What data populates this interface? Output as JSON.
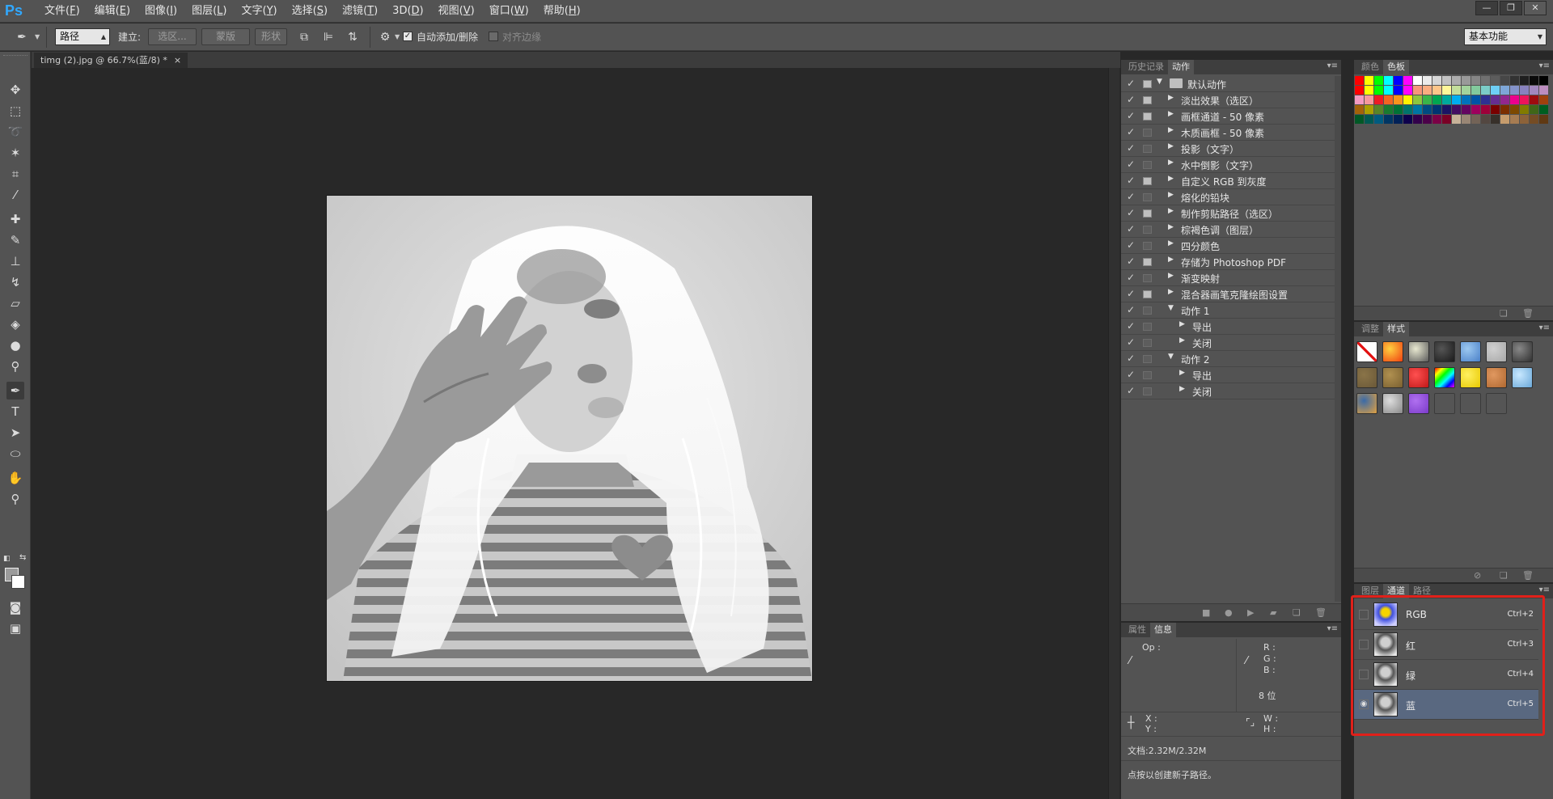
{
  "app": {
    "logo": "Ps"
  },
  "menu": [
    {
      "label": "文件",
      "key": "F"
    },
    {
      "label": "编辑",
      "key": "E"
    },
    {
      "label": "图像",
      "key": "I"
    },
    {
      "label": "图层",
      "key": "L"
    },
    {
      "label": "文字",
      "key": "Y"
    },
    {
      "label": "选择",
      "key": "S"
    },
    {
      "label": "滤镜",
      "key": "T"
    },
    {
      "label": "3D",
      "key": "D"
    },
    {
      "label": "视图",
      "key": "V"
    },
    {
      "label": "窗口",
      "key": "W"
    },
    {
      "label": "帮助",
      "key": "H"
    }
  ],
  "window_controls": {
    "minimize": "—",
    "restore": "❐",
    "close": "✕"
  },
  "options": {
    "mode_select": "路径",
    "make_label": "建立:",
    "selection_btn": "选区...",
    "mask_btn": "蒙版",
    "shape_btn": "形状",
    "auto_add_delete_label": "自动添加/删除",
    "auto_add_delete_checked": true,
    "align_edges_label": "对齐边缘",
    "align_edges_checked": false,
    "workspace": "基本功能"
  },
  "document": {
    "tab_title": "timg (2).jpg @ 66.7%(蓝/8) *",
    "tab_close": "×"
  },
  "panels": {
    "history_tab": "历史记录",
    "actions_tab": "动作",
    "properties_tab": "属性",
    "info_tab": "信息",
    "color_tab": "颜色",
    "swatches_tab": "色板",
    "adjustments_tab": "调整",
    "styles_tab": "样式",
    "layers_tab": "图层",
    "channels_tab": "通道",
    "paths_tab": "路径"
  },
  "actions": [
    {
      "label": "默认动作",
      "level": 0,
      "type": "set",
      "expanded": true,
      "dialog": true
    },
    {
      "label": "淡出效果（选区）",
      "level": 1,
      "expanded": false,
      "dialog": true
    },
    {
      "label": "画框通道 - 50 像素",
      "level": 1,
      "expanded": false,
      "dialog": true
    },
    {
      "label": "木质画框 - 50 像素",
      "level": 1,
      "expanded": false,
      "dialog": false
    },
    {
      "label": "投影（文字）",
      "level": 1,
      "expanded": false,
      "dialog": false
    },
    {
      "label": "水中倒影（文字）",
      "level": 1,
      "expanded": false,
      "dialog": false
    },
    {
      "label": "自定义 RGB 到灰度",
      "level": 1,
      "expanded": false,
      "dialog": true
    },
    {
      "label": "熔化的铅块",
      "level": 1,
      "expanded": false,
      "dialog": false
    },
    {
      "label": "制作剪贴路径（选区）",
      "level": 1,
      "expanded": false,
      "dialog": true
    },
    {
      "label": "棕褐色调（图层）",
      "level": 1,
      "expanded": false,
      "dialog": false
    },
    {
      "label": "四分颜色",
      "level": 1,
      "expanded": false,
      "dialog": false
    },
    {
      "label": "存储为 Photoshop PDF",
      "level": 1,
      "expanded": false,
      "dialog": true
    },
    {
      "label": "渐变映射",
      "level": 1,
      "expanded": false,
      "dialog": false
    },
    {
      "label": "混合器画笔克隆绘图设置",
      "level": 1,
      "expanded": false,
      "dialog": true
    },
    {
      "label": "动作 1",
      "level": 1,
      "expanded": true,
      "dialog": false
    },
    {
      "label": "导出",
      "level": 2,
      "expanded": false,
      "dialog": false
    },
    {
      "label": "关闭",
      "level": 2,
      "expanded": false,
      "dialog": false
    },
    {
      "label": "动作 2",
      "level": 1,
      "expanded": true,
      "dialog": false
    },
    {
      "label": "导出",
      "level": 2,
      "expanded": false,
      "dialog": false
    },
    {
      "label": "关闭",
      "level": 2,
      "expanded": false,
      "dialog": false
    }
  ],
  "info": {
    "op_label": "Op :",
    "r_label": "R :",
    "g_label": "G :",
    "b_label": "B :",
    "bit_depth": "8 位",
    "x_label": "X :",
    "y_label": "Y :",
    "w_label": "W :",
    "h_label": "H :",
    "doc_size": "文档:2.32M/2.32M",
    "hint": "点按以创建新子路径。"
  },
  "channels": [
    {
      "name": "RGB",
      "shortcut": "Ctrl+2",
      "visible": false,
      "selected": false,
      "thumb": "color"
    },
    {
      "name": "红",
      "shortcut": "Ctrl+3",
      "visible": false,
      "selected": false,
      "thumb": "gray"
    },
    {
      "name": "绿",
      "shortcut": "Ctrl+4",
      "visible": false,
      "selected": false,
      "thumb": "gray"
    },
    {
      "name": "蓝",
      "shortcut": "Ctrl+5",
      "visible": true,
      "selected": true,
      "thumb": "gray"
    }
  ],
  "swatch_colors": [
    "#ff0000",
    "#ffff00",
    "#00ff00",
    "#00ffff",
    "#0000ff",
    "#ff00ff",
    "#ffffff",
    "#ebebeb",
    "#d6d6d6",
    "#c2c2c2",
    "#adadad",
    "#999999",
    "#858585",
    "#707070",
    "#5c5c5c",
    "#474747",
    "#333333",
    "#1f1f1f",
    "#0a0a0a",
    "#000000",
    "#ff0000",
    "#ffff00",
    "#00ff00",
    "#00ffff",
    "#0000ff",
    "#ff00ff",
    "#f7977a",
    "#f9ad81",
    "#fdc68a",
    "#fff79a",
    "#c4df9b",
    "#a2d39c",
    "#82ca9d",
    "#7bcdc8",
    "#6ecff6",
    "#7ea7d8",
    "#8493ca",
    "#8882be",
    "#a187be",
    "#bc8dbf",
    "#f49ac2",
    "#f6989d",
    "#ed1c24",
    "#f26522",
    "#f7941d",
    "#fff200",
    "#8dc73f",
    "#39b54a",
    "#00a651",
    "#00a99d",
    "#00aeef",
    "#0072bc",
    "#0054a6",
    "#2e3192",
    "#662d91",
    "#92278f",
    "#ec008c",
    "#ed145b",
    "#9e0b0f",
    "#a0410d",
    "#a36209",
    "#aba000",
    "#598527",
    "#197b30",
    "#007236",
    "#00746b",
    "#0076a3",
    "#004b80",
    "#003471",
    "#1b1464",
    "#440e62",
    "#630460",
    "#9e005d",
    "#9e0039",
    "#790000",
    "#7b2e00",
    "#7d4900",
    "#827b00",
    "#406618",
    "#005e20",
    "#005826",
    "#005952",
    "#005b7f",
    "#003663",
    "#002157",
    "#0d004c",
    "#32004b",
    "#4b0049",
    "#7b0046",
    "#7a0026",
    "#c7b299",
    "#998675",
    "#736357",
    "#534741",
    "#37302a",
    "#c69c6d",
    "#a67c52",
    "#8c6239",
    "#754c24",
    "#603913"
  ],
  "style_tiles": [
    {
      "bg": "#ffffff",
      "fg": "#e21010",
      "kind": "none"
    },
    {
      "bg": "#f04010",
      "fg": "#ffd040",
      "kind": "glow"
    },
    {
      "bg": "#5a5a5a",
      "fg": "#e8e8d0",
      "kind": "frame"
    },
    {
      "bg": "#1a1a1a",
      "fg": "#555",
      "kind": "dark"
    },
    {
      "bg": "#4a80c8",
      "fg": "#9cc8f0",
      "kind": "blue"
    },
    {
      "bg": "#a8a8a8",
      "fg": "#d0d0d0",
      "kind": "flat"
    },
    {
      "bg": "#303030",
      "fg": "#888",
      "kind": "grad"
    },
    {
      "bg": "#6a5838",
      "fg": "#8a7448",
      "kind": "wood"
    },
    {
      "bg": "#7a6030",
      "fg": "#b09050",
      "kind": "bronze"
    },
    {
      "bg": "#c01818",
      "fg": "#ff5050",
      "kind": "red"
    },
    {
      "bg": "#222",
      "fg": "#e04",
      "kind": "rainbow"
    },
    {
      "bg": "#e8c800",
      "fg": "#fff060",
      "kind": "gold"
    },
    {
      "bg": "#b06830",
      "fg": "#e09860",
      "kind": "copper"
    },
    {
      "bg": "#6aa8d8",
      "fg": "#c8e8ff",
      "kind": "sky"
    },
    {
      "bg": "#e0a040",
      "fg": "#3a6aa8",
      "kind": "sunset"
    },
    {
      "bg": "#888",
      "fg": "#ddd",
      "kind": "texture"
    },
    {
      "bg": "#7a3ac8",
      "fg": "#b070f0",
      "kind": "purple"
    },
    {
      "bg": "#555",
      "fg": "#666",
      "kind": "empty"
    },
    {
      "bg": "#555",
      "fg": "#666",
      "kind": "empty"
    },
    {
      "bg": "#555",
      "fg": "#666",
      "kind": "empty"
    }
  ]
}
